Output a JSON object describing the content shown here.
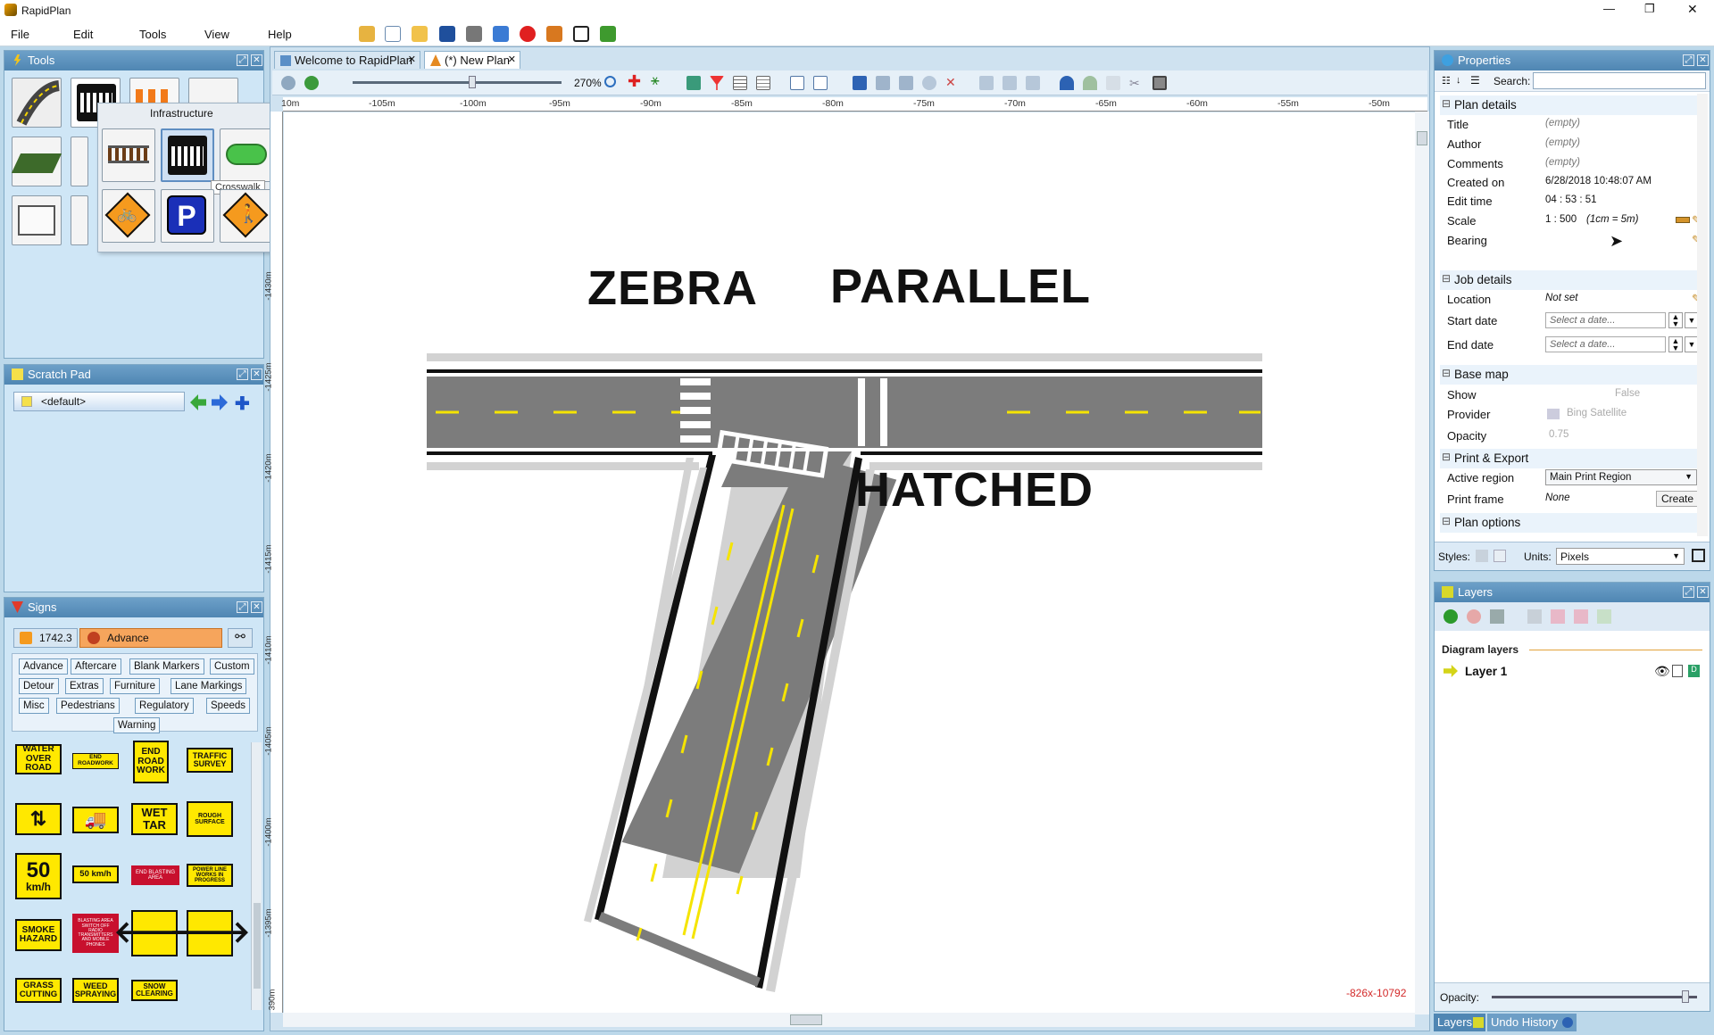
{
  "app": {
    "title": "RapidPlan"
  },
  "window_controls": {
    "minimize": "—",
    "maximize": "❐",
    "close": "✕"
  },
  "menu": [
    "File",
    "Edit",
    "Tools",
    "View",
    "Help"
  ],
  "doc_tabs": [
    {
      "label": "Welcome to RapidPlan"
    },
    {
      "label": "(*) New Plan"
    }
  ],
  "tools_panel": {
    "title": "Tools",
    "flyout_title": "Infrastructure",
    "tooltip": "Crosswalk"
  },
  "scratch_pad": {
    "title": "Scratch Pad",
    "selected": "<default>"
  },
  "signs_panel": {
    "title": "Signs",
    "standard": "1742.3",
    "category": "Advance",
    "filters": [
      "Advance",
      "Aftercare",
      "Blank Markers",
      "Custom",
      "Detour",
      "Extras",
      "Furniture",
      "Lane Markings",
      "Misc",
      "Pedestrians",
      "Regulatory",
      "Speeds",
      "Warning"
    ],
    "signs": {
      "water": "WATER OVER ROAD",
      "end_roadwork": "END ROADWORK",
      "end_road_work": "END ROAD WORK",
      "traffic_survey": "TRAFFIC SURVEY",
      "wet_tar": "WET TAR",
      "rough": "ROUGH SURFACE",
      "km50": "50",
      "kmh": "km/h",
      "km50_small": "50 km/h",
      "end_blasting": "END BLASTING AREA",
      "power_line": "POWER LINE WORKS IN PROGRESS",
      "smoke": "SMOKE HAZARD",
      "blasting": "BLASTING AREA SWITCH OFF RADIO TRANSMITTERS AND MOBILE PHONES",
      "grass": "GRASS CUTTING",
      "weed": "WEED SPRAYING",
      "snow": "SNOW CLEARING"
    }
  },
  "canvas": {
    "zoom": "270%",
    "coord_readout": "-826x-10792",
    "top_ruler": [
      "10m",
      "-105m",
      "-100m",
      "-95m",
      "-90m",
      "-85m",
      "-80m",
      "-75m",
      "-70m",
      "-65m",
      "-60m",
      "-55m",
      "-50m"
    ],
    "left_ruler": [
      "-1430m",
      "-1425m",
      "-1420m",
      "-1415m",
      "-1410m",
      "-1405m",
      "-1400m",
      "-1395m",
      "390m"
    ],
    "labels": {
      "zebra": "ZEBRA",
      "parallel": "PARALLEL",
      "hatched": "HATCHED"
    }
  },
  "properties": {
    "title": "Properties",
    "search_label": "Search:",
    "sections": {
      "plan_details": "Plan details",
      "job_details": "Job details",
      "base_map": "Base map",
      "print_export": "Print & Export",
      "plan_options": "Plan options"
    },
    "title_label": "Title",
    "title_value": "(empty)",
    "author_label": "Author",
    "author_value": "(empty)",
    "comments_label": "Comments",
    "comments_value": "(empty)",
    "created_label": "Created on",
    "created_value": "6/28/2018 10:48:07 AM",
    "edit_label": "Edit time",
    "edit_value": "04 : 53 : 51",
    "scale_label": "Scale",
    "scale_value": "1 : 500",
    "scale_note": "(1cm = 5m)",
    "bearing_label": "Bearing",
    "location_label": "Location",
    "location_value": "Not set",
    "start_label": "Start date",
    "start_placeholder": "Select a date...",
    "end_label": "End date",
    "end_placeholder": "Select a date...",
    "show_label": "Show",
    "show_value": "False",
    "provider_label": "Provider",
    "provider_value": "Bing Satellite",
    "opacity_label": "Opacity",
    "opacity_value": "0.75",
    "active_region_label": "Active region",
    "active_region_value": "Main Print Region",
    "print_frame_label": "Print frame",
    "print_frame_value": "None",
    "create_btn": "Create",
    "styles_label": "Styles:",
    "units_label": "Units:",
    "units_value": "Pixels"
  },
  "layers": {
    "title": "Layers",
    "diagram_layers": "Diagram layers",
    "layer1": "Layer 1",
    "opacity_label": "Opacity:",
    "opacity_fraction": 0.96
  },
  "bottom_tabs": [
    "Layers",
    "Undo History"
  ]
}
